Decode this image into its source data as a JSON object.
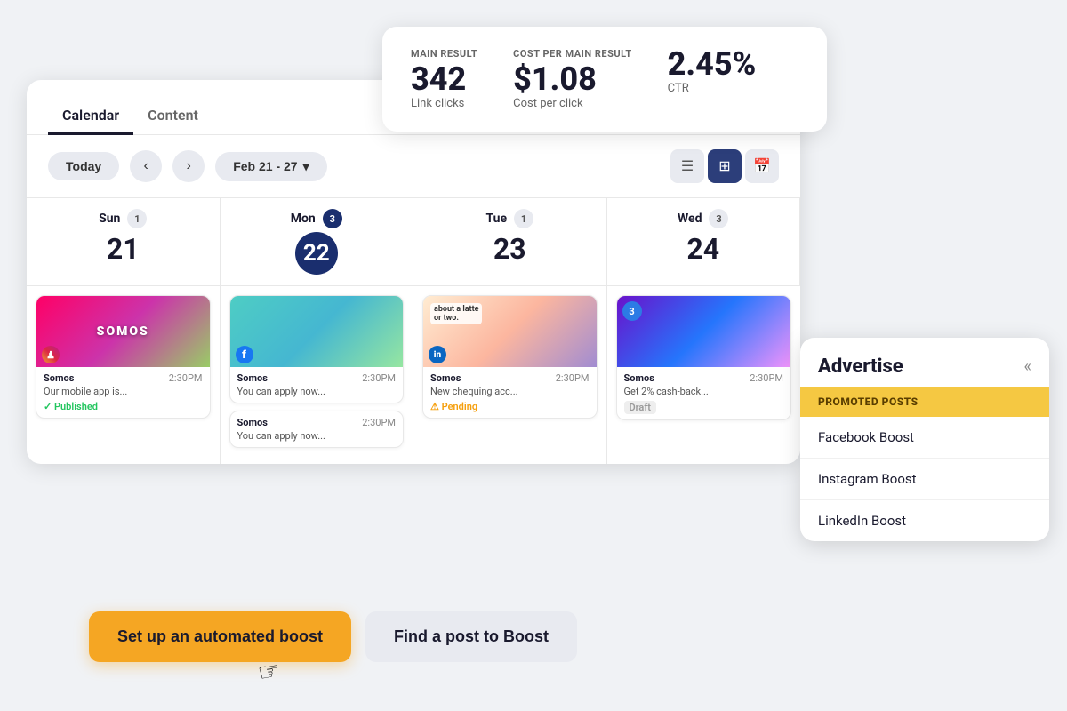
{
  "stats": {
    "main_result_label": "MAIN RESULT",
    "main_result_value": "342",
    "main_result_sub": "Link clicks",
    "cost_label": "COST PER MAIN RESULT",
    "cost_value": "$1.08",
    "cost_sub": "Cost per click",
    "ctr_value": "2.45%",
    "ctr_sub": "CTR"
  },
  "calendar": {
    "tab_calendar": "Calendar",
    "tab_content": "Content",
    "btn_today": "Today",
    "date_range": "Feb 21 - 27",
    "date_range_chevron": "▾",
    "days": [
      {
        "name": "Sun",
        "num": "21",
        "badge": "1",
        "is_circle": false
      },
      {
        "name": "Mon",
        "num": "22",
        "badge": "3",
        "is_circle": true
      },
      {
        "name": "Tue",
        "num": "23",
        "badge": "1",
        "is_circle": false
      },
      {
        "name": "Wed",
        "num": "24",
        "badge": "3",
        "is_circle": false
      }
    ],
    "posts": {
      "sun": [
        {
          "account": "Somos",
          "time": "2:30PM",
          "text": "Our mobile app is...",
          "status": "Published",
          "social": "ig"
        }
      ],
      "mon": [
        {
          "account": "Somos",
          "time": "2:30PM",
          "text": "You can apply now...",
          "status": null,
          "social": "fb"
        },
        {
          "account": "Somos",
          "time": "2:30PM",
          "text": "You can apply now...",
          "status": null,
          "social": "fb"
        }
      ],
      "tue": [
        {
          "account": "Somos",
          "time": "2:30PM",
          "text": "New chequing acc...",
          "status": "Pending",
          "social": "li"
        }
      ],
      "wed": [
        {
          "account": "Somos",
          "time": "2:30PM",
          "text": "Get 2% cash-back...",
          "status": "Draft",
          "social": null,
          "badge": "3"
        }
      ]
    }
  },
  "actions": {
    "automated_boost": "Set up an automated boost",
    "find_boost": "Find a post to Boost"
  },
  "advertise": {
    "title": "Advertise",
    "collapse": "«",
    "section_header": "PROMOTED POSTS",
    "items": [
      "Facebook Boost",
      "Instagram Boost",
      "LinkedIn Boost"
    ]
  }
}
